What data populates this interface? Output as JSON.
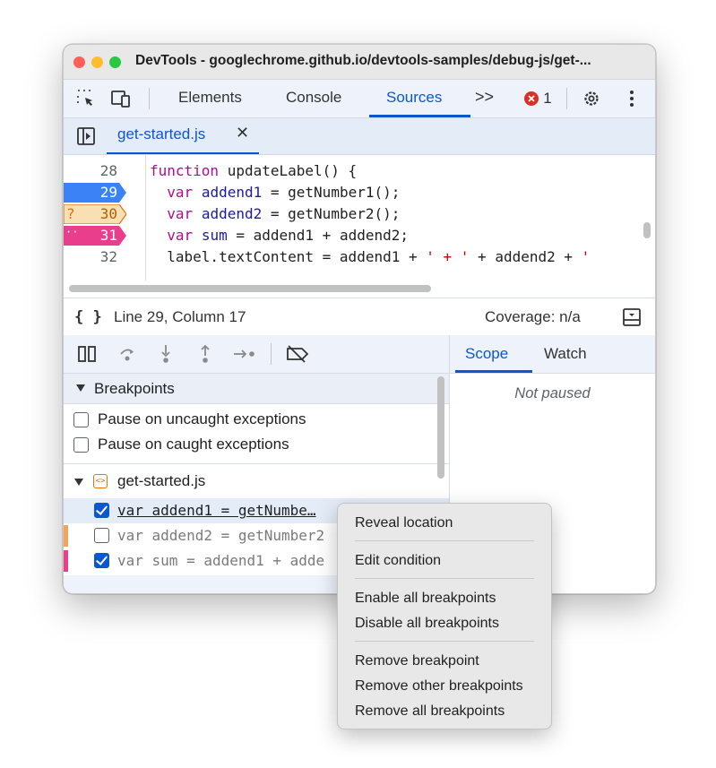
{
  "window": {
    "title": "DevTools - googlechrome.github.io/devtools-samples/debug-js/get-..."
  },
  "toolbar": {
    "tabs": [
      {
        "label": "Elements"
      },
      {
        "label": "Console"
      },
      {
        "label": "Sources",
        "active": true
      }
    ],
    "more_label": ">>",
    "error_count": "1",
    "icons": [
      "inspect-element-icon",
      "device-toolbar-icon",
      "error-icon",
      "settings-gear-icon",
      "more-vertical-icon"
    ]
  },
  "file_tab": {
    "name": "get-started.js",
    "close": "✕"
  },
  "code": {
    "lines": [
      {
        "num": "28",
        "text": "function updateLabel() {"
      },
      {
        "num": "29",
        "text": "  var addend1 = getNumber1();",
        "breakpoint": "regular"
      },
      {
        "num": "30",
        "text": "  var addend2 = getNumber2();",
        "breakpoint": "conditional",
        "marker_prefix": "?"
      },
      {
        "num": "31",
        "text": "  var sum = addend1 + addend2;",
        "breakpoint": "logpoint",
        "marker_prefix": "··"
      },
      {
        "num": "32",
        "text": "  label.textContent = addend1 + ' + ' + addend2 + '"
      }
    ]
  },
  "status": {
    "position": "Line 29, Column 17",
    "coverage": "Coverage: n/a",
    "format_icon": "{ }"
  },
  "right_panel": {
    "tabs": [
      {
        "label": "Scope",
        "active": true
      },
      {
        "label": "Watch"
      }
    ],
    "message": "Not paused"
  },
  "breakpoints": {
    "header": "Breakpoints",
    "options": [
      {
        "label": "Pause on uncaught exceptions",
        "checked": false
      },
      {
        "label": "Pause on caught exceptions",
        "checked": false
      }
    ],
    "file": "get-started.js",
    "items": [
      {
        "text": "var addend1 = getNumbe…",
        "checked": true
      },
      {
        "text": "var addend2 = getNumber2",
        "checked": false
      },
      {
        "text": "var sum = addend1 + adde",
        "checked": true
      }
    ]
  },
  "context_menu": {
    "items": [
      "Reveal location",
      "Edit condition",
      "Enable all breakpoints",
      "Disable all breakpoints",
      "Remove breakpoint",
      "Remove other breakpoints",
      "Remove all breakpoints"
    ]
  },
  "colors": {
    "accent": "#0b57d0",
    "breakpoint_regular": "#3b82f6",
    "breakpoint_conditional": "#f9dfb4",
    "breakpoint_logpoint": "#e83e8c",
    "error_red": "#d93025"
  }
}
